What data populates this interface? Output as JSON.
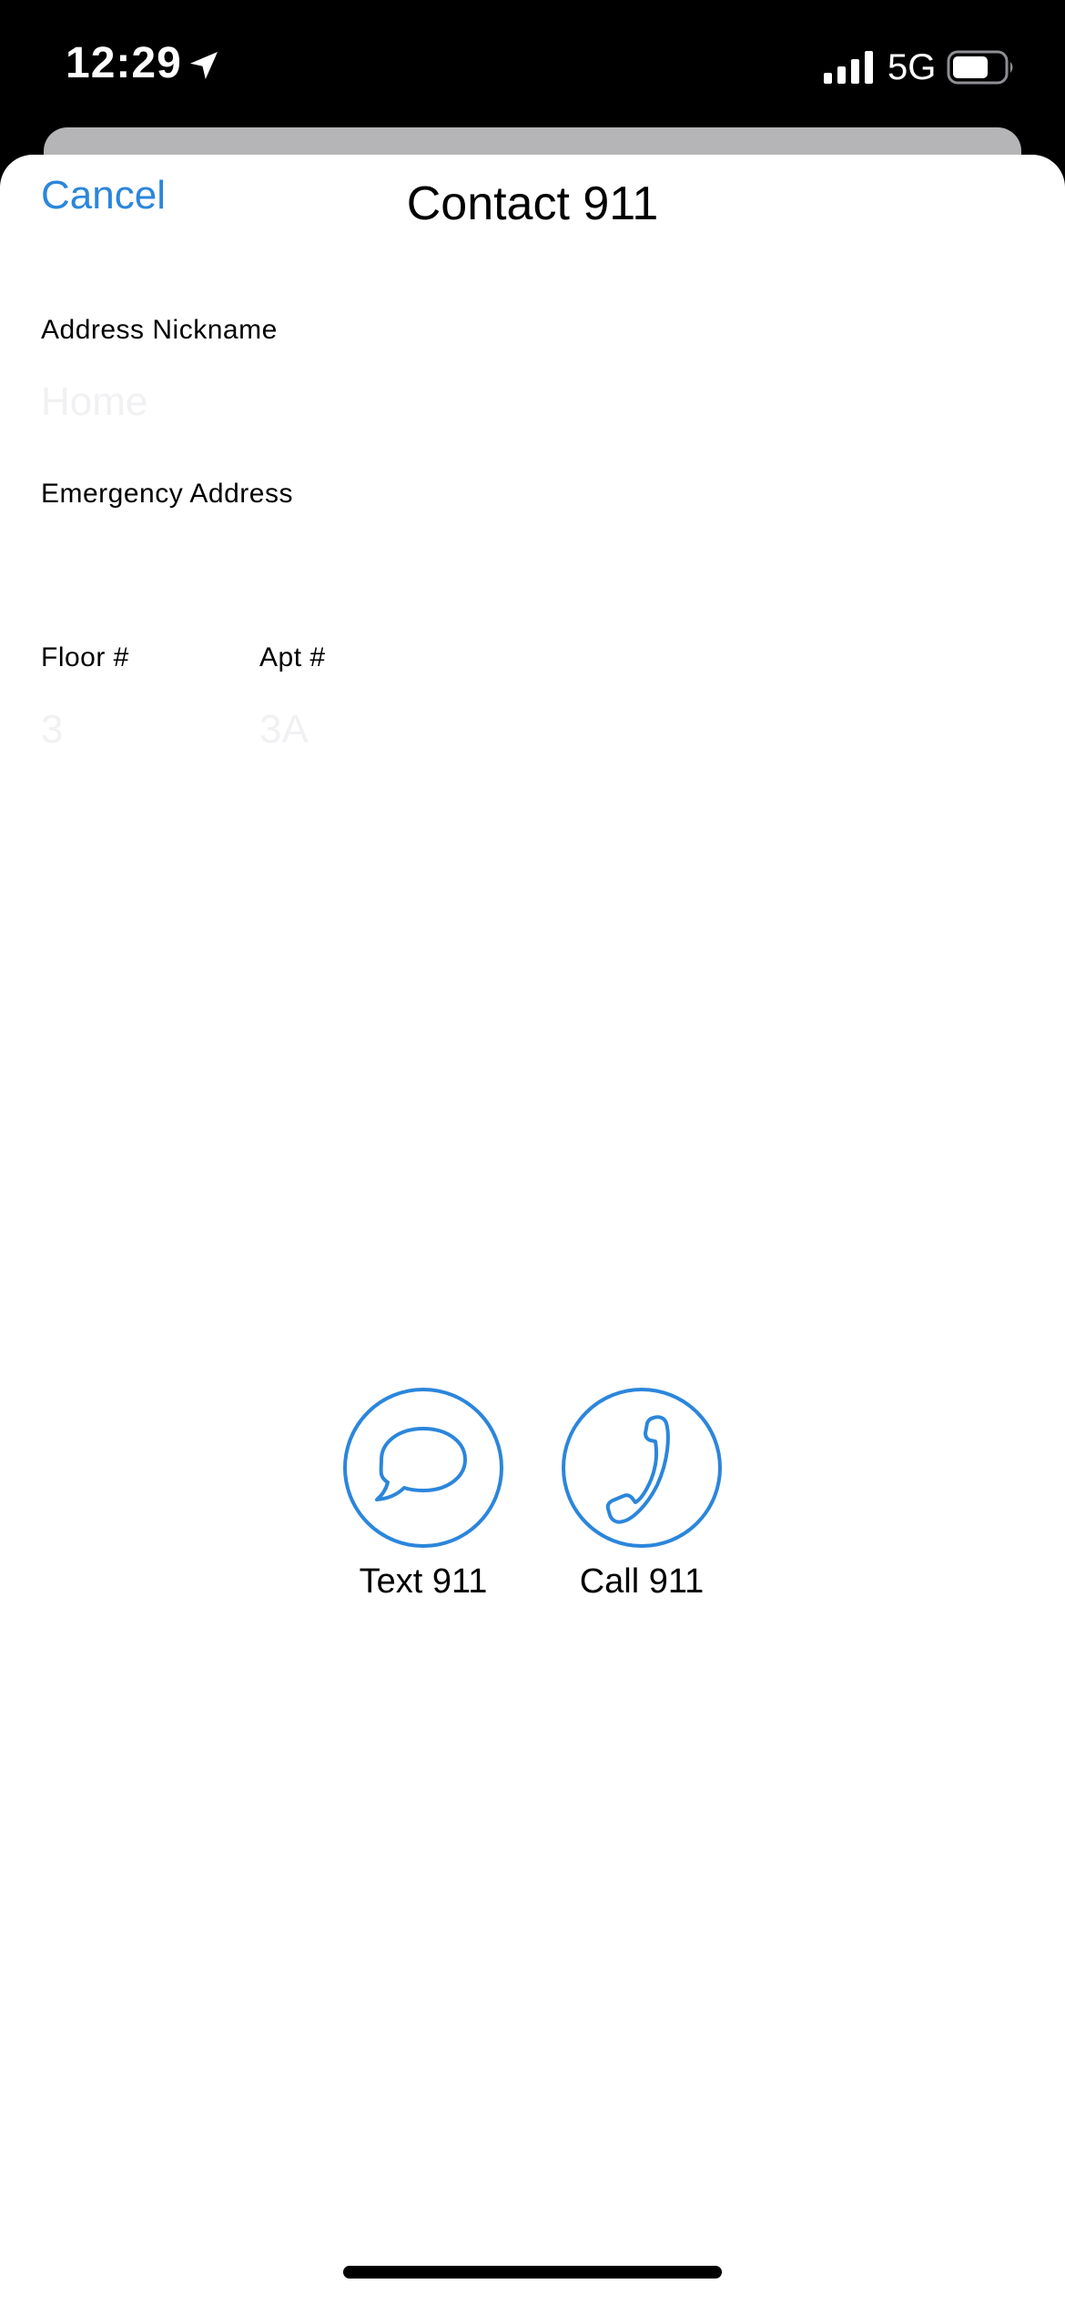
{
  "status_bar": {
    "time": "12:29",
    "network": "5G",
    "icons": [
      "location-arrow-icon",
      "signal-bars-icon",
      "battery-icon"
    ]
  },
  "header": {
    "cancel_label": "Cancel",
    "title": "Contact 911"
  },
  "form": {
    "nickname": {
      "label": "Address Nickname",
      "placeholder": "Home",
      "value": ""
    },
    "address": {
      "label": "Emergency Address",
      "placeholder": "",
      "value": ""
    },
    "floor": {
      "label": "Floor #",
      "placeholder": "3",
      "value": ""
    },
    "apt": {
      "label": "Apt #",
      "placeholder": "3A",
      "value": ""
    }
  },
  "actions": {
    "text": {
      "label": "Text 911",
      "icon": "speech-bubble-icon"
    },
    "call": {
      "label": "Call 911",
      "icon": "phone-handset-icon"
    }
  },
  "colors": {
    "accent": "#2b86dc",
    "status_bar_bg": "#000000",
    "sheet_bg": "#ffffff",
    "placeholder": "#f1f1f3"
  }
}
